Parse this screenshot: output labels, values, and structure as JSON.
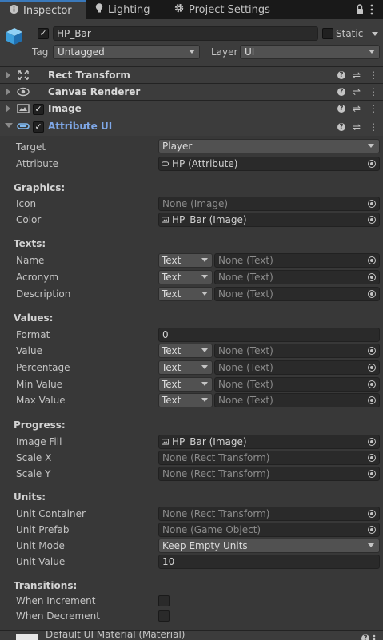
{
  "tabs": [
    {
      "label": "Inspector",
      "icon": "info-icon"
    },
    {
      "label": "Lighting",
      "icon": "bulb-icon"
    },
    {
      "label": "Project Settings",
      "icon": "gear-icon"
    }
  ],
  "gameobject": {
    "name": "HP_Bar",
    "active": true,
    "static_label": "Static",
    "tag_label": "Tag",
    "tag_value": "Untagged",
    "layer_label": "Layer",
    "layer_value": "UI"
  },
  "components": [
    {
      "title": "Rect Transform",
      "icon": "rect-transform-icon"
    },
    {
      "title": "Canvas Renderer",
      "icon": "eye-icon"
    },
    {
      "title": "Image",
      "icon": "image-icon",
      "enabled": true
    },
    {
      "title": "Attribute UI",
      "icon": "script-icon",
      "enabled": true
    }
  ],
  "attribute_ui": {
    "target_label": "Target",
    "target_value": "Player",
    "attribute_label": "Attribute",
    "attribute_value": "HP (Attribute)",
    "graphics": {
      "heading": "Graphics:",
      "icon_label": "Icon",
      "icon_value": "None (Image)",
      "color_label": "Color",
      "color_value": "HP_Bar (Image)"
    },
    "texts": {
      "heading": "Texts:",
      "rows": [
        {
          "label": "Name",
          "mode": "Text",
          "value": "None (Text)"
        },
        {
          "label": "Acronym",
          "mode": "Text",
          "value": "None (Text)"
        },
        {
          "label": "Description",
          "mode": "Text",
          "value": "None (Text)"
        }
      ]
    },
    "values": {
      "heading": "Values:",
      "format_label": "Format",
      "format_value": "0",
      "rows": [
        {
          "label": "Value",
          "mode": "Text",
          "value": "None (Text)"
        },
        {
          "label": "Percentage",
          "mode": "Text",
          "value": "None (Text)"
        },
        {
          "label": "Min Value",
          "mode": "Text",
          "value": "None (Text)"
        },
        {
          "label": "Max Value",
          "mode": "Text",
          "value": "None (Text)"
        }
      ]
    },
    "progress": {
      "heading": "Progress:",
      "fill_label": "Image Fill",
      "fill_value": "HP_Bar (Image)",
      "scalex_label": "Scale X",
      "scalex_value": "None (Rect Transform)",
      "scaley_label": "Scale Y",
      "scaley_value": "None (Rect Transform)"
    },
    "units": {
      "heading": "Units:",
      "container_label": "Unit Container",
      "container_value": "None (Rect Transform)",
      "prefab_label": "Unit Prefab",
      "prefab_value": "None (Game Object)",
      "mode_label": "Unit Mode",
      "mode_value": "Keep Empty Units",
      "value_label": "Unit Value",
      "value_value": "10"
    },
    "transitions": {
      "heading": "Transitions:",
      "increment_label": "When Increment",
      "decrement_label": "When Decrement"
    }
  },
  "footer": {
    "material": "Default UI Material (Material)"
  },
  "colors": {
    "accent": "#3a79bb",
    "background": "#383838",
    "header": "#3c3c3c",
    "script_title": "#7fa8e8"
  }
}
